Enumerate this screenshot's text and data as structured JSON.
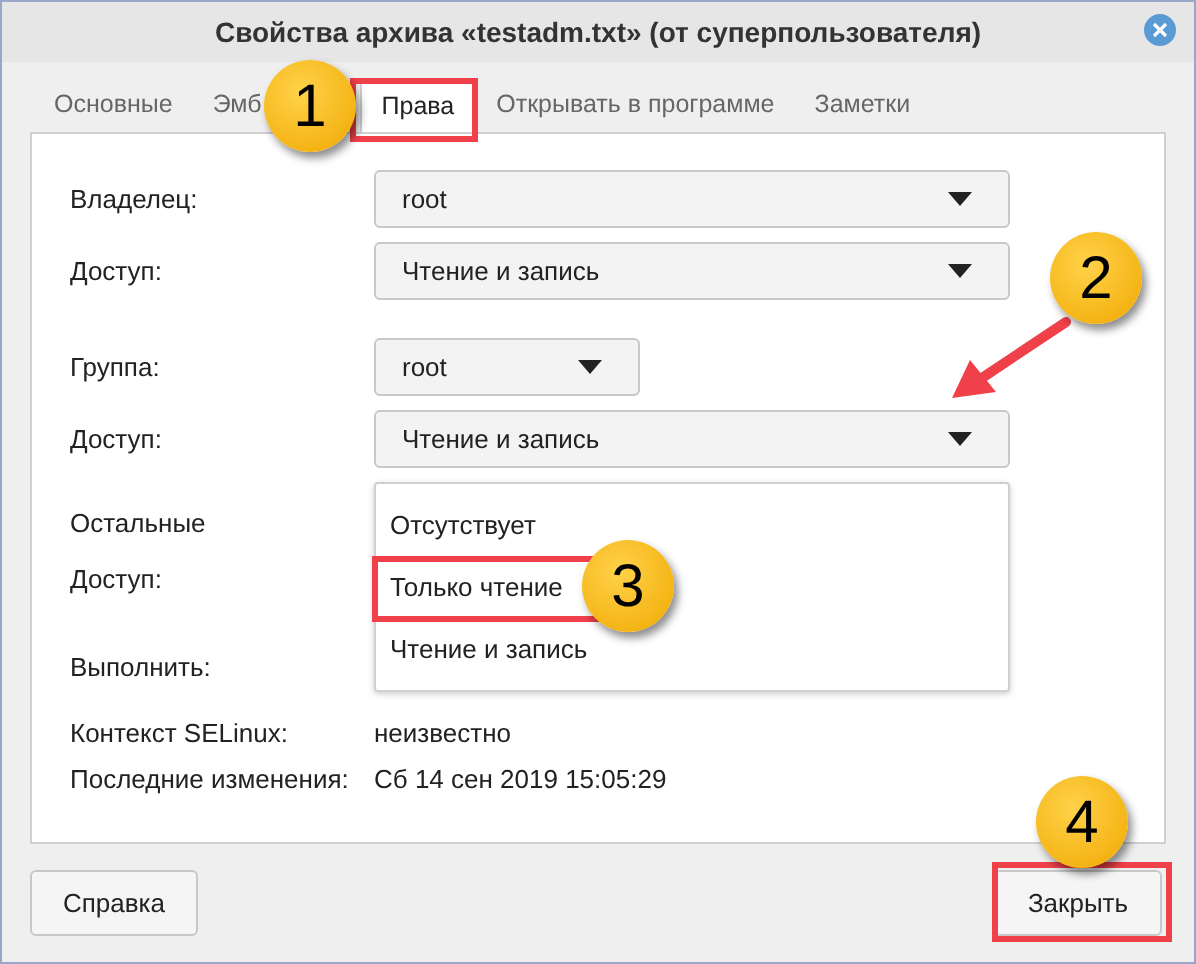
{
  "window": {
    "title": "Свойства архива «testadm.txt» (от суперпользователя)"
  },
  "tabs": [
    {
      "label": "Основные",
      "selected": false
    },
    {
      "label": "Эмб",
      "selected": false
    },
    {
      "label": "Права",
      "selected": true
    },
    {
      "label": "Открывать в программе",
      "selected": false
    },
    {
      "label": "Заметки",
      "selected": false
    }
  ],
  "owner": {
    "label": "Владелец:",
    "value": "root",
    "access_label": "Доступ:",
    "access": "Чтение и запись"
  },
  "group": {
    "label": "Группа:",
    "value": "root",
    "access_label": "Доступ:",
    "access": "Чтение и запись"
  },
  "access_menu": [
    {
      "label": "Отсутствует"
    },
    {
      "label": "Только чтение"
    },
    {
      "label": "Чтение и запись"
    }
  ],
  "others": {
    "label": "Остальные",
    "access_label": "Доступ:",
    "execute_label": "Выполнить:"
  },
  "info": [
    {
      "label": "Контекст SELinux:",
      "value": "неизвестно"
    },
    {
      "label": "Последние изменения:",
      "value": "Сб 14 сен 2019 15:05:29"
    }
  ],
  "buttons": {
    "help": "Справка",
    "close": "Закрыть"
  },
  "annotations": [
    {
      "label": "1"
    },
    {
      "label": "2"
    },
    {
      "label": "3"
    },
    {
      "label": "4"
    }
  ]
}
